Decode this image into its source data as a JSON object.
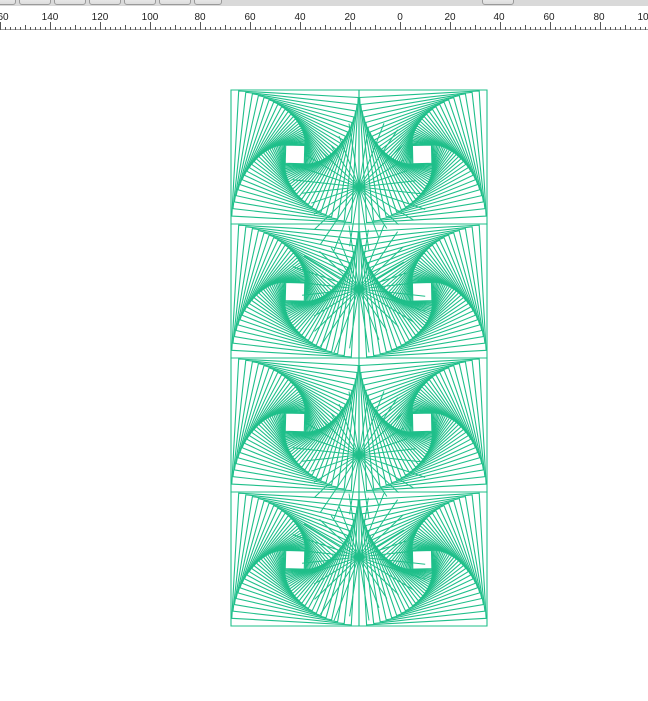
{
  "ruler": {
    "labels": [
      "60",
      "140",
      "120",
      "100",
      "80",
      "60",
      "40",
      "20",
      "0",
      "20",
      "40",
      "60",
      "80",
      "10"
    ]
  },
  "artwork": {
    "stroke_color": "#1fbf8a",
    "tiles": 8,
    "rows": 4,
    "columns": 2
  }
}
